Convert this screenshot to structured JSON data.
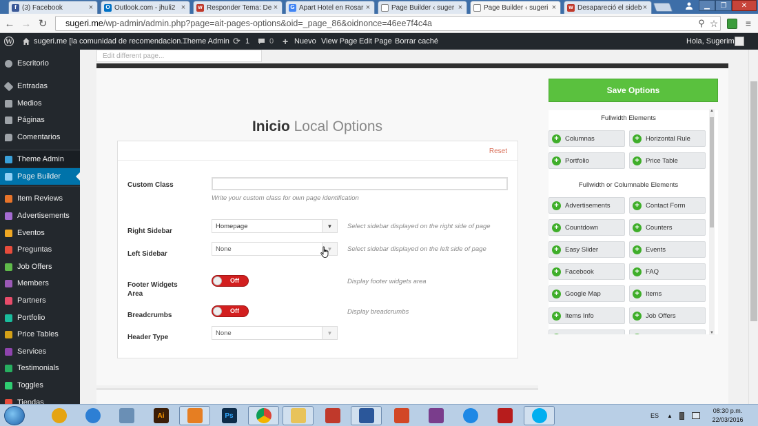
{
  "browser": {
    "tabs": [
      {
        "title": "(3) Facebook",
        "favicon": "facebook-icon",
        "color": "#3b5998"
      },
      {
        "title": "Outlook.com - jhuli2",
        "favicon": "outlook-icon",
        "color": "#0072c6"
      },
      {
        "title": "Responder Tema: De",
        "favicon": "wordpress-forum-icon",
        "color": "#c0392b"
      },
      {
        "title": "Apart Hotel en Rosar",
        "favicon": "google-icon",
        "color": "#4285f4"
      },
      {
        "title": "Page Builder ‹ suger",
        "favicon": "page-icon",
        "color": "#888888"
      },
      {
        "title": "Page Builder ‹ sugeri",
        "favicon": "page-icon",
        "color": "#888888"
      },
      {
        "title": "Desapareció el sideb",
        "favicon": "wordpress-forum-icon",
        "color": "#c0392b"
      }
    ],
    "url_prefix": "sugeri.me",
    "url_rest": "/wp-admin/admin.php?page=ait-pages-options&oid=_page_86&oidnonce=46ee7f4c4a"
  },
  "adminbar": {
    "site_name": "sugeri.me [la comunidad de recomendacion...",
    "theme_admin": "Theme Admin",
    "updates_count": "1",
    "comments_count": "0",
    "new_label": "Nuevo",
    "view_page": "View Page",
    "edit_page": "Edit Page",
    "clear_cache": "Borrar caché",
    "greeting": "Hola, Sugerime"
  },
  "sidebar": {
    "items": [
      {
        "label": "Escritorio",
        "icon": "dashboard-icon",
        "color": "#9ea3a8"
      },
      {
        "label": "Entradas",
        "icon": "pin-icon",
        "color": "#9ea3a8"
      },
      {
        "label": "Medios",
        "icon": "media-icon",
        "color": "#9ea3a8"
      },
      {
        "label": "Páginas",
        "icon": "pages-icon",
        "color": "#9ea3a8"
      },
      {
        "label": "Comentarios",
        "icon": "comments-icon",
        "color": "#9ea3a8"
      },
      {
        "label": "Theme Admin",
        "icon": "theme-admin-icon",
        "color": "#3aa0d8"
      },
      {
        "label": "Page Builder",
        "icon": "page-builder-icon",
        "color": "#3aa0d8"
      },
      {
        "label": "Item Reviews",
        "icon": "item-reviews-icon",
        "color": "#e7742a"
      },
      {
        "label": "Advertisements",
        "icon": "advertisements-icon",
        "color": "#a46bd1"
      },
      {
        "label": "Eventos",
        "icon": "eventos-icon",
        "color": "#f0a723"
      },
      {
        "label": "Preguntas",
        "icon": "preguntas-icon",
        "color": "#e74c3c"
      },
      {
        "label": "Job Offers",
        "icon": "job-offers-icon",
        "color": "#5fb94a"
      },
      {
        "label": "Members",
        "icon": "members-icon",
        "color": "#9b59b6"
      },
      {
        "label": "Partners",
        "icon": "partners-icon",
        "color": "#e74c6a"
      },
      {
        "label": "Portfolio",
        "icon": "portfolio-icon",
        "color": "#1abc9c"
      },
      {
        "label": "Price Tables",
        "icon": "price-tables-icon",
        "color": "#d4a017"
      },
      {
        "label": "Services",
        "icon": "services-icon",
        "color": "#8e44ad"
      },
      {
        "label": "Testimonials",
        "icon": "testimonials-icon",
        "color": "#27ae60"
      },
      {
        "label": "Toggles",
        "icon": "toggles-icon",
        "color": "#2ecc71"
      },
      {
        "label": "Tiendas",
        "icon": "tiendas-icon",
        "color": "#e74c3c"
      }
    ]
  },
  "main": {
    "edit_different_page": "Edit different page...",
    "heading_bold": "Inicio",
    "heading_light": "Local Options",
    "reset": "Reset",
    "custom_class": {
      "label": "Custom Class",
      "value": "",
      "help": "Write your custom class for own page identification"
    },
    "right_sidebar": {
      "label": "Right Sidebar",
      "value": "Homepage",
      "help": "Select sidebar displayed on the right side of page"
    },
    "left_sidebar": {
      "label": "Left Sidebar",
      "value": "None",
      "help": "Select sidebar displayed on the left side of page"
    },
    "footer_widgets": {
      "label_line1": "Footer Widgets",
      "label_line2": "Area",
      "state": "Off",
      "help": "Display footer widgets area"
    },
    "breadcrumbs": {
      "label": "Breadcrumbs",
      "state": "Off",
      "help": "Display breadcrumbs"
    },
    "header_type": {
      "label": "Header Type",
      "value": "None"
    }
  },
  "right_panel": {
    "save_label": "Save Options",
    "fullwidth_heading": "Fullwidth Elements",
    "fullwidth": [
      "Columnas",
      "Horizontal Rule",
      "Portfolio",
      "Price Table"
    ],
    "columnable_heading": "Fullwidth or Columnable Elements",
    "columnable": [
      "Advertisements",
      "Contact Form",
      "Countdown",
      "Counters",
      "Easy Slider",
      "Events",
      "Facebook",
      "FAQ",
      "Google Map",
      "Items",
      "Items Info",
      "Job Offers"
    ]
  },
  "taskbar": {
    "apps": [
      {
        "name": "ie-legacy-icon",
        "color": "#e5a412"
      },
      {
        "name": "media-app-icon",
        "color": "#2d7fd4"
      },
      {
        "name": "tools-icon",
        "color": "#6a8fb5"
      },
      {
        "name": "illustrator-icon",
        "color": "#3b1d07"
      },
      {
        "name": "media-player-icon",
        "color": "#e67e22"
      },
      {
        "name": "photoshop-icon",
        "color": "#0d2b48"
      },
      {
        "name": "chrome-icon",
        "color": "#db4437"
      },
      {
        "name": "file-explorer-icon",
        "color": "#e8c35a"
      },
      {
        "name": "acrobat-icon",
        "color": "#c0392b"
      },
      {
        "name": "word-icon",
        "color": "#2b579a"
      },
      {
        "name": "powerpoint-icon",
        "color": "#d24726"
      },
      {
        "name": "winrar-icon",
        "color": "#7a3d8c"
      },
      {
        "name": "ie-icon",
        "color": "#1e88e5"
      },
      {
        "name": "filezilla-icon",
        "color": "#b71c1c"
      },
      {
        "name": "skype-icon",
        "color": "#00aff0"
      }
    ],
    "ie_label": "Ai",
    "ps_label": "Ps",
    "lang": "ES",
    "time": "08:30 p.m.",
    "date": "22/03/2016"
  }
}
